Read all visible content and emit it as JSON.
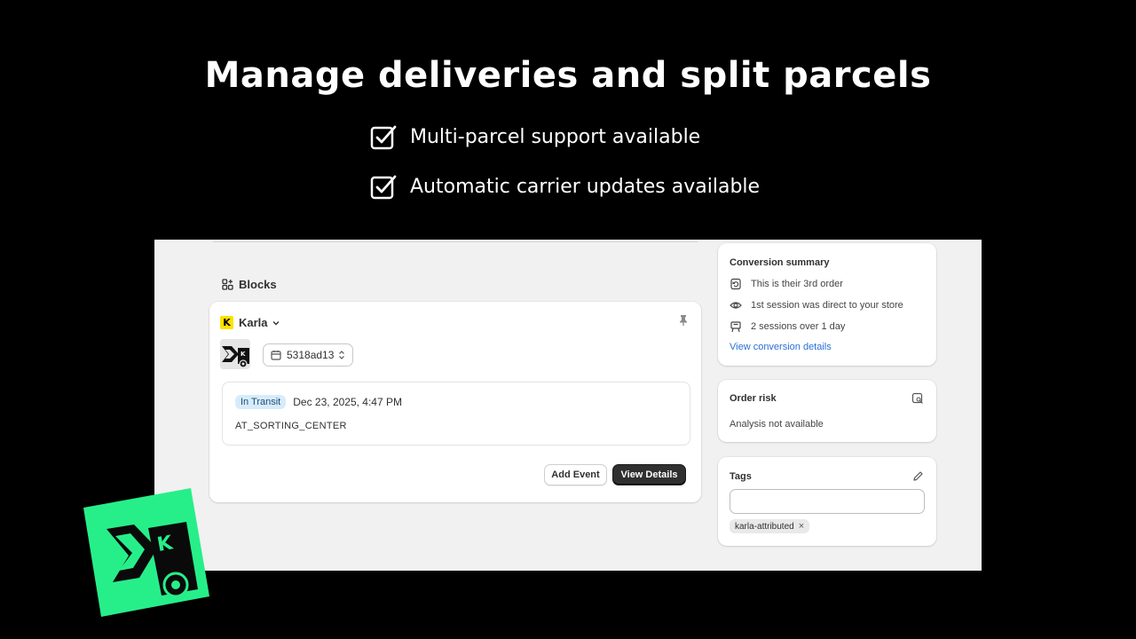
{
  "headline": "Manage deliveries and split parcels",
  "features": [
    {
      "text": "Multi-parcel support available"
    },
    {
      "text": "Automatic carrier updates available"
    }
  ],
  "blocks": {
    "heading": "Blocks",
    "app_name": "Karla",
    "app_logo_letter": "K",
    "tracking_id": "5318ad13",
    "status_badge": "In Transit",
    "timestamp": "Dec 23, 2025, 4:47 PM",
    "event_code": "AT_SORTING_CENTER",
    "add_event_label": "Add Event",
    "view_details_label": "View Details"
  },
  "conversion": {
    "title": "Conversion summary",
    "items": [
      {
        "icon": "repeat-order-icon",
        "text": "This is their 3rd order"
      },
      {
        "icon": "eye-icon",
        "text": "1st session was direct to your store"
      },
      {
        "icon": "sessions-icon",
        "text": "2 sessions over 1 day"
      }
    ],
    "link": "View conversion details"
  },
  "risk": {
    "title": "Order risk",
    "text": "Analysis not available"
  },
  "tags": {
    "title": "Tags",
    "input_value": "",
    "chips": [
      "karla-attributed"
    ]
  },
  "colors": {
    "background": "#000000",
    "brand_green": "#26ef8a",
    "badge_blue": "#d7ecfb",
    "link_blue": "#2b6fd6",
    "karla_yellow": "#ffe100"
  }
}
